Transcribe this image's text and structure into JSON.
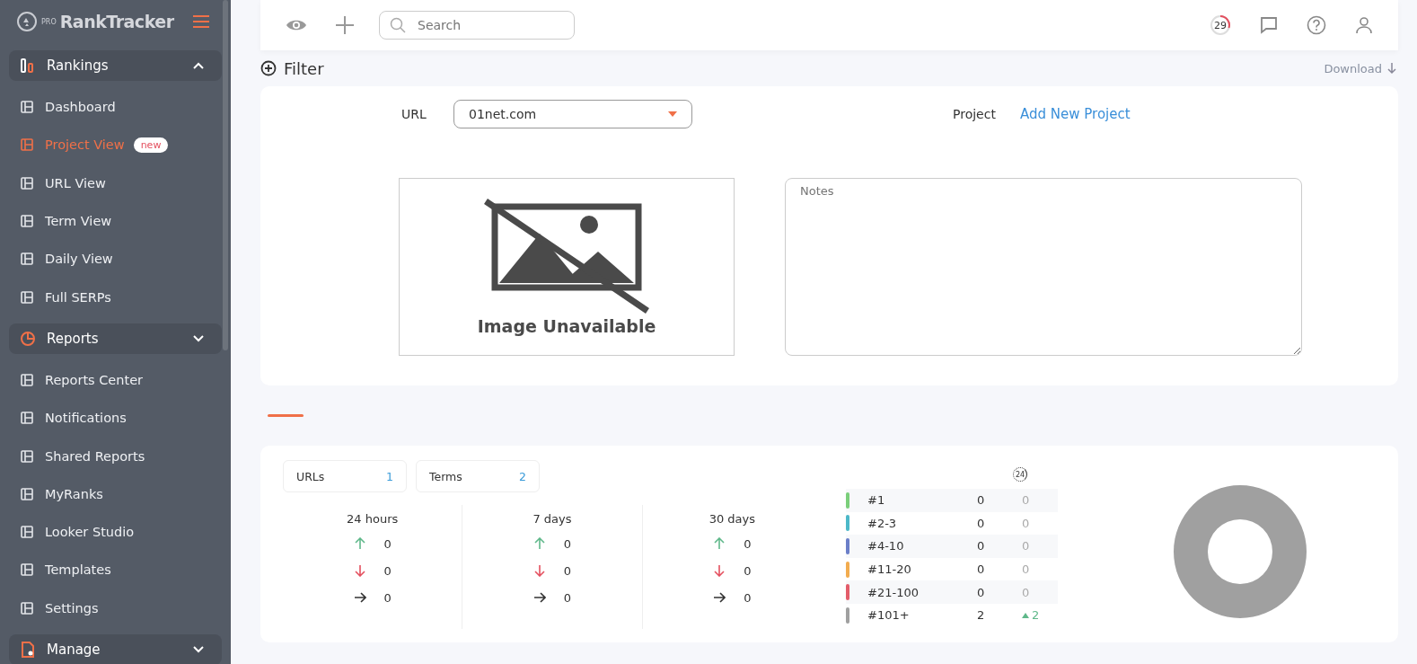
{
  "sidebar": {
    "logo_badge": "PRO",
    "logo": "RankTracker",
    "groups": [
      {
        "label": "Rankings",
        "expanded": true,
        "items": [
          {
            "label": "Dashboard",
            "selected": false
          },
          {
            "label": "Project View",
            "selected": true,
            "badge": "new"
          },
          {
            "label": "URL View",
            "selected": false
          },
          {
            "label": "Term View",
            "selected": false
          },
          {
            "label": "Daily View",
            "selected": false
          },
          {
            "label": "Full SERPs",
            "selected": false
          }
        ]
      },
      {
        "label": "Reports",
        "expanded": false,
        "items": [
          {
            "label": "Reports Center",
            "selected": false
          },
          {
            "label": "Notifications",
            "selected": false
          },
          {
            "label": "Shared Reports",
            "selected": false
          },
          {
            "label": "MyRanks",
            "selected": false
          },
          {
            "label": "Looker Studio",
            "selected": false
          },
          {
            "label": "Templates",
            "selected": false
          },
          {
            "label": "Settings",
            "selected": false
          }
        ]
      },
      {
        "label": "Manage",
        "expanded": false
      }
    ]
  },
  "header": {
    "search": {
      "placeholder": "Search"
    },
    "credits": "29"
  },
  "filter": {
    "label": "Filter",
    "download": "Download"
  },
  "project": {
    "url_label": "URL",
    "url_value": "01net.com",
    "project_label": "Project",
    "add_project": "Add New Project",
    "image_text": "Image Unavailable",
    "notes": {
      "placeholder": "Notes"
    }
  },
  "stats": {
    "counters": [
      {
        "label": "URLs",
        "value": "1"
      },
      {
        "label": "Terms",
        "value": "2"
      }
    ],
    "periods": [
      {
        "label": "24 hours",
        "up": "0",
        "down": "0",
        "same": "0"
      },
      {
        "label": "7 days",
        "up": "0",
        "down": "0",
        "same": "0"
      },
      {
        "label": "30 days",
        "up": "0",
        "down": "0",
        "same": "0"
      }
    ],
    "history_badge": "24",
    "rankings": [
      {
        "label": "#1",
        "color": "#7bcf7b",
        "count": "0",
        "change": "0",
        "increased": false
      },
      {
        "label": "#2-3",
        "color": "#4cb8c8",
        "count": "0",
        "change": "0",
        "increased": false
      },
      {
        "label": "#4-10",
        "color": "#6b7fc8",
        "count": "0",
        "change": "0",
        "increased": false
      },
      {
        "label": "#11-20",
        "color": "#f2ac4f",
        "count": "0",
        "change": "0",
        "increased": false
      },
      {
        "label": "#21-100",
        "color": "#e35d6a",
        "count": "0",
        "change": "0",
        "increased": false
      },
      {
        "label": "#101+",
        "color": "#a0a0a0",
        "count": "2",
        "change": "2",
        "increased": true
      }
    ]
  }
}
